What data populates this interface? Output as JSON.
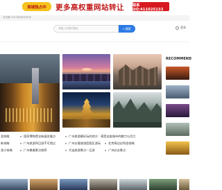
{
  "top_banner": {
    "badge": "商城独占中",
    "headline": "更多高权重网站转让",
    "qq": "联系QQ:411025133"
  },
  "date_bar": {
    "text": "今天是 2022年06月30日"
  },
  "search": {
    "placeholder": "请输入关键词搜索",
    "button_label": "搜索"
  },
  "header": {
    "login_label": "登录"
  },
  "sidebar": {
    "title": "RECOMMEND"
  },
  "articles": [
    {
      "text": "游攻略"
    },
    {
      "text": "国家博物馆全新展览看点"
    },
    {
      "text": "广州旅游最好玩的地方：感受这座城市的魅力与活力"
    },
    {
      "text": "新攻略"
    },
    {
      "text": "广州旅游四日游不可错过"
    },
    {
      "text": "广州长隆旅游度假区游玩"
    },
    {
      "text": "北京周边自驾游攻略"
    },
    {
      "text": "游小攻略"
    },
    {
      "text": "广州最美景点推荐"
    },
    {
      "text": "大连旅游景点—日游"
    },
    {
      "text": "广州必去景点"
    }
  ]
}
